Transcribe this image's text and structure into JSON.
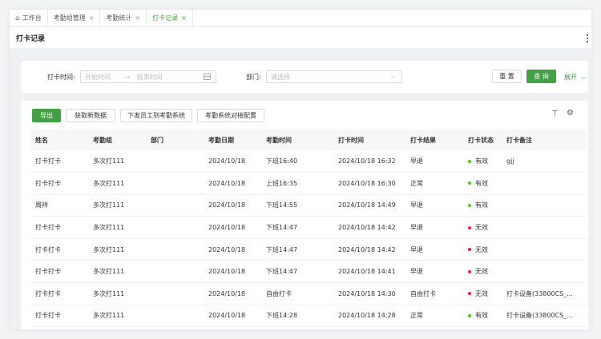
{
  "tabs": [
    {
      "label": "工作台",
      "closable": false,
      "active": false
    },
    {
      "label": "考勤组管理",
      "closable": true,
      "active": false
    },
    {
      "label": "考勤统计",
      "closable": true,
      "active": false
    },
    {
      "label": "打卡记录",
      "closable": true,
      "active": true
    }
  ],
  "tab_close_glyph": "×",
  "page_title": "打卡记录",
  "filter": {
    "time_label": "打卡时间:",
    "start_placeholder": "开始时间",
    "range_sep": "→",
    "end_placeholder": "结束时间",
    "dept_label": "部门:",
    "dept_placeholder": "请选择",
    "reset_label": "重 置",
    "search_label": "查 询",
    "expand_label": "展开"
  },
  "toolbar": {
    "export_label": "导出",
    "fetch_label": "获取新数据",
    "push_label": "下发员工到考勤系统",
    "config_label": "考勤系统对接配置"
  },
  "table": {
    "columns": [
      "姓名",
      "考勤组",
      "部门",
      "考勤日期",
      "考勤时间",
      "打卡时间",
      "打卡结果",
      "打卡状态",
      "打卡备注"
    ],
    "rows": [
      {
        "name": "打卡打卡",
        "group": "多次打111",
        "dept": "",
        "date": "2024/10/18",
        "shift": "下班16:40",
        "punch": "2024/10/18 16:32",
        "result": "早退",
        "status": "有效",
        "valid": true,
        "note": "gjj"
      },
      {
        "name": "打卡打卡",
        "group": "多次打111",
        "dept": "",
        "date": "2024/10/18",
        "shift": "上班16:35",
        "punch": "2024/10/18 16:30",
        "result": "正常",
        "status": "有效",
        "valid": true,
        "note": ""
      },
      {
        "name": "周祥",
        "group": "多次打111",
        "dept": "",
        "date": "2024/10/18",
        "shift": "下班14:55",
        "punch": "2024/10/18 14:49",
        "result": "早退",
        "status": "有效",
        "valid": true,
        "note": ""
      },
      {
        "name": "打卡打卡",
        "group": "多次打111",
        "dept": "",
        "date": "2024/10/18",
        "shift": "下班14:47",
        "punch": "2024/10/18 14:42",
        "result": "早退",
        "status": "无效",
        "valid": false,
        "note": ""
      },
      {
        "name": "打卡打卡",
        "group": "多次打111",
        "dept": "",
        "date": "2024/10/18",
        "shift": "下班14:47",
        "punch": "2024/10/18 14:42",
        "result": "早退",
        "status": "无效",
        "valid": false,
        "note": ""
      },
      {
        "name": "打卡打卡",
        "group": "多次打111",
        "dept": "",
        "date": "2024/10/18",
        "shift": "下班14:47",
        "punch": "2024/10/18 14:41",
        "result": "早退",
        "status": "无效",
        "valid": false,
        "note": ""
      },
      {
        "name": "打卡打卡",
        "group": "多次打111",
        "dept": "",
        "date": "2024/10/18",
        "shift": "自由打卡",
        "punch": "2024/10/18 14:30",
        "result": "自由打卡",
        "status": "无效",
        "valid": false,
        "note": "打卡设备(33800CS_..."
      },
      {
        "name": "打卡打卡",
        "group": "多次打111",
        "dept": "",
        "date": "2024/10/18",
        "shift": "下班14:28",
        "punch": "2024/10/18 14:28",
        "result": "正常",
        "status": "有效",
        "valid": true,
        "note": "打卡设备(33800CS_..."
      }
    ]
  },
  "colors": {
    "accent": "#43a047",
    "valid_dot": "#52c41a",
    "invalid_dot": "#f5222d"
  },
  "icons": {
    "home": "home-icon",
    "calendar": "calendar-icon",
    "chevron": "chevron-down-icon",
    "column_height": "column-height-icon",
    "settings": "gear-icon",
    "more": "more-vertical-icon"
  }
}
